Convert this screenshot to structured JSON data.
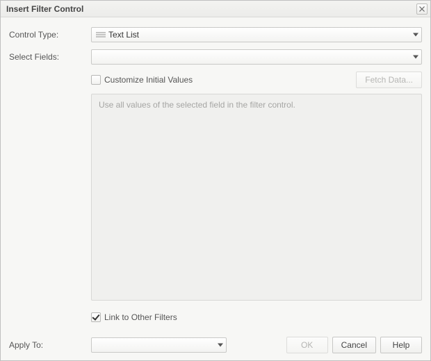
{
  "dialog": {
    "title": "Insert Filter Control"
  },
  "labels": {
    "control_type": "Control Type:",
    "select_fields": "Select Fields:",
    "apply_to": "Apply To:"
  },
  "control_type": {
    "value": "Text List"
  },
  "select_fields": {
    "value": ""
  },
  "customize": {
    "label": "Customize Initial Values",
    "checked": false
  },
  "fetch_button": {
    "label": "Fetch Data...",
    "enabled": false
  },
  "initial_values": {
    "placeholder": "Use all values of the selected field in the filter control."
  },
  "link_filters": {
    "label": "Link to Other Filters",
    "checked": true
  },
  "apply_to": {
    "value": ""
  },
  "buttons": {
    "ok": "OK",
    "cancel": "Cancel",
    "help": "Help",
    "ok_enabled": false
  }
}
